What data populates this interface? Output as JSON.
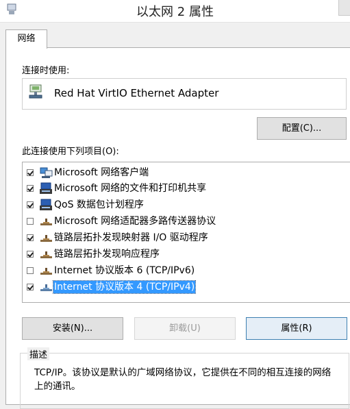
{
  "window": {
    "title": "以太网 2 属性"
  },
  "tabs": [
    {
      "label": "网络"
    }
  ],
  "connect_using": {
    "label": "连接时使用:",
    "adapter": "Red Hat VirtIO Ethernet Adapter",
    "configure_button": "配置(C)..."
  },
  "items_label": "此连接使用下列项目(O):",
  "items": [
    {
      "label": "Microsoft 网络客户端",
      "checked": true,
      "icon": "network-client-icon"
    },
    {
      "label": "Microsoft 网络的文件和打印机共享",
      "checked": true,
      "icon": "file-printer-share-icon"
    },
    {
      "label": "QoS 数据包计划程序",
      "checked": true,
      "icon": "qos-packet-scheduler-icon"
    },
    {
      "label": "Microsoft 网络适配器多路传送器协议",
      "checked": false,
      "icon": "protocol-icon"
    },
    {
      "label": "链路层拓扑发现映射器 I/O 驱动程序",
      "checked": true,
      "icon": "protocol-icon"
    },
    {
      "label": "链路层拓扑发现响应程序",
      "checked": true,
      "icon": "protocol-icon"
    },
    {
      "label": "Internet 协议版本 6 (TCP/IPv6)",
      "checked": false,
      "icon": "protocol-icon"
    },
    {
      "label": "Internet 协议版本 4 (TCP/IPv4)",
      "checked": true,
      "icon": "protocol-icon",
      "selected": true
    }
  ],
  "buttons": {
    "install": "安装(N)...",
    "uninstall": "卸载(U)",
    "properties": "属性(R)"
  },
  "description": {
    "legend": "描述",
    "text": "TCP/IP。该协议是默认的广域网络协议，它提供在不同的相互连接的网络上的通讯。"
  },
  "colors": {
    "selection": "#3399ff",
    "window_bg": "#f0f0f0"
  }
}
